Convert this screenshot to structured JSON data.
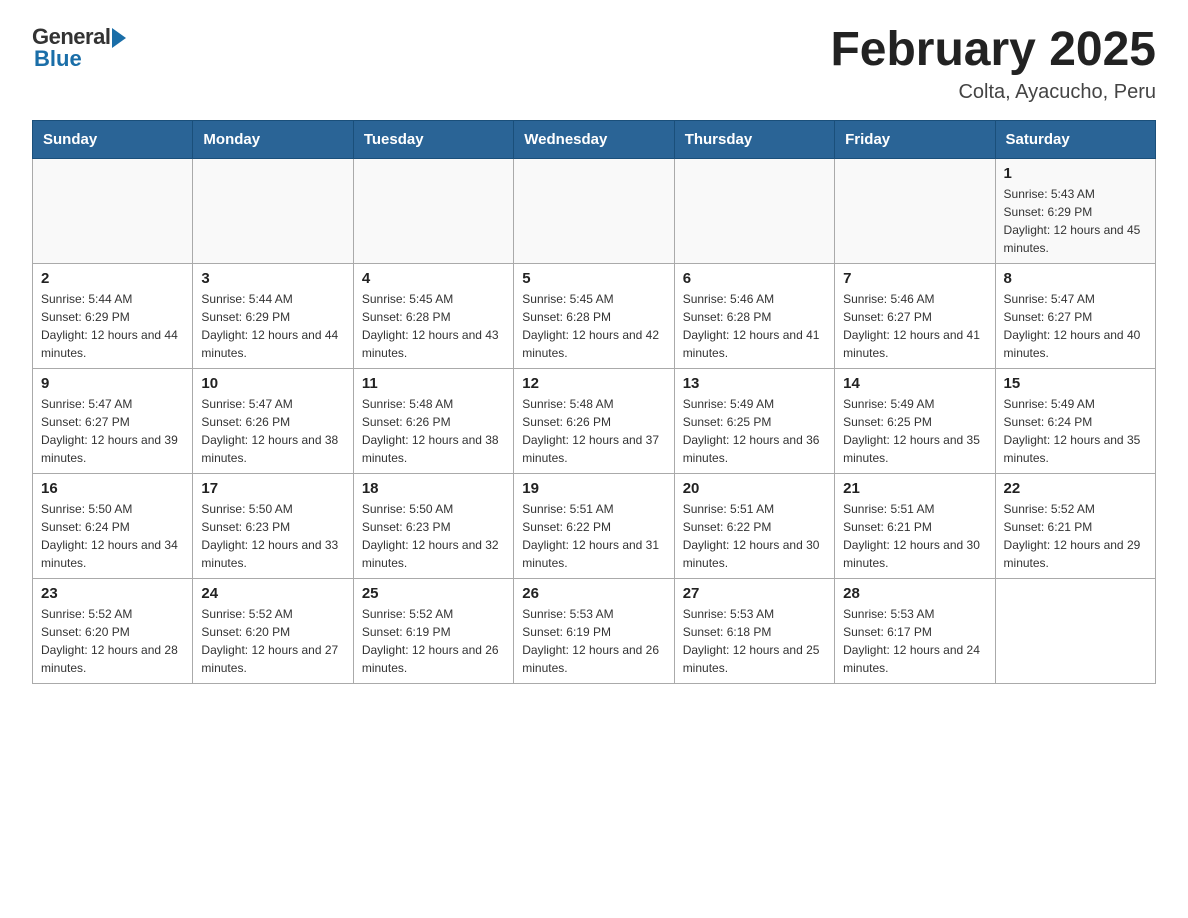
{
  "header": {
    "logo_general": "General",
    "logo_blue": "Blue",
    "title": "February 2025",
    "subtitle": "Colta, Ayacucho, Peru"
  },
  "days_of_week": [
    "Sunday",
    "Monday",
    "Tuesday",
    "Wednesday",
    "Thursday",
    "Friday",
    "Saturday"
  ],
  "weeks": [
    [
      {
        "day": "",
        "info": ""
      },
      {
        "day": "",
        "info": ""
      },
      {
        "day": "",
        "info": ""
      },
      {
        "day": "",
        "info": ""
      },
      {
        "day": "",
        "info": ""
      },
      {
        "day": "",
        "info": ""
      },
      {
        "day": "1",
        "info": "Sunrise: 5:43 AM\nSunset: 6:29 PM\nDaylight: 12 hours and 45 minutes."
      }
    ],
    [
      {
        "day": "2",
        "info": "Sunrise: 5:44 AM\nSunset: 6:29 PM\nDaylight: 12 hours and 44 minutes."
      },
      {
        "day": "3",
        "info": "Sunrise: 5:44 AM\nSunset: 6:29 PM\nDaylight: 12 hours and 44 minutes."
      },
      {
        "day": "4",
        "info": "Sunrise: 5:45 AM\nSunset: 6:28 PM\nDaylight: 12 hours and 43 minutes."
      },
      {
        "day": "5",
        "info": "Sunrise: 5:45 AM\nSunset: 6:28 PM\nDaylight: 12 hours and 42 minutes."
      },
      {
        "day": "6",
        "info": "Sunrise: 5:46 AM\nSunset: 6:28 PM\nDaylight: 12 hours and 41 minutes."
      },
      {
        "day": "7",
        "info": "Sunrise: 5:46 AM\nSunset: 6:27 PM\nDaylight: 12 hours and 41 minutes."
      },
      {
        "day": "8",
        "info": "Sunrise: 5:47 AM\nSunset: 6:27 PM\nDaylight: 12 hours and 40 minutes."
      }
    ],
    [
      {
        "day": "9",
        "info": "Sunrise: 5:47 AM\nSunset: 6:27 PM\nDaylight: 12 hours and 39 minutes."
      },
      {
        "day": "10",
        "info": "Sunrise: 5:47 AM\nSunset: 6:26 PM\nDaylight: 12 hours and 38 minutes."
      },
      {
        "day": "11",
        "info": "Sunrise: 5:48 AM\nSunset: 6:26 PM\nDaylight: 12 hours and 38 minutes."
      },
      {
        "day": "12",
        "info": "Sunrise: 5:48 AM\nSunset: 6:26 PM\nDaylight: 12 hours and 37 minutes."
      },
      {
        "day": "13",
        "info": "Sunrise: 5:49 AM\nSunset: 6:25 PM\nDaylight: 12 hours and 36 minutes."
      },
      {
        "day": "14",
        "info": "Sunrise: 5:49 AM\nSunset: 6:25 PM\nDaylight: 12 hours and 35 minutes."
      },
      {
        "day": "15",
        "info": "Sunrise: 5:49 AM\nSunset: 6:24 PM\nDaylight: 12 hours and 35 minutes."
      }
    ],
    [
      {
        "day": "16",
        "info": "Sunrise: 5:50 AM\nSunset: 6:24 PM\nDaylight: 12 hours and 34 minutes."
      },
      {
        "day": "17",
        "info": "Sunrise: 5:50 AM\nSunset: 6:23 PM\nDaylight: 12 hours and 33 minutes."
      },
      {
        "day": "18",
        "info": "Sunrise: 5:50 AM\nSunset: 6:23 PM\nDaylight: 12 hours and 32 minutes."
      },
      {
        "day": "19",
        "info": "Sunrise: 5:51 AM\nSunset: 6:22 PM\nDaylight: 12 hours and 31 minutes."
      },
      {
        "day": "20",
        "info": "Sunrise: 5:51 AM\nSunset: 6:22 PM\nDaylight: 12 hours and 30 minutes."
      },
      {
        "day": "21",
        "info": "Sunrise: 5:51 AM\nSunset: 6:21 PM\nDaylight: 12 hours and 30 minutes."
      },
      {
        "day": "22",
        "info": "Sunrise: 5:52 AM\nSunset: 6:21 PM\nDaylight: 12 hours and 29 minutes."
      }
    ],
    [
      {
        "day": "23",
        "info": "Sunrise: 5:52 AM\nSunset: 6:20 PM\nDaylight: 12 hours and 28 minutes."
      },
      {
        "day": "24",
        "info": "Sunrise: 5:52 AM\nSunset: 6:20 PM\nDaylight: 12 hours and 27 minutes."
      },
      {
        "day": "25",
        "info": "Sunrise: 5:52 AM\nSunset: 6:19 PM\nDaylight: 12 hours and 26 minutes."
      },
      {
        "day": "26",
        "info": "Sunrise: 5:53 AM\nSunset: 6:19 PM\nDaylight: 12 hours and 26 minutes."
      },
      {
        "day": "27",
        "info": "Sunrise: 5:53 AM\nSunset: 6:18 PM\nDaylight: 12 hours and 25 minutes."
      },
      {
        "day": "28",
        "info": "Sunrise: 5:53 AM\nSunset: 6:17 PM\nDaylight: 12 hours and 24 minutes."
      },
      {
        "day": "",
        "info": ""
      }
    ]
  ]
}
